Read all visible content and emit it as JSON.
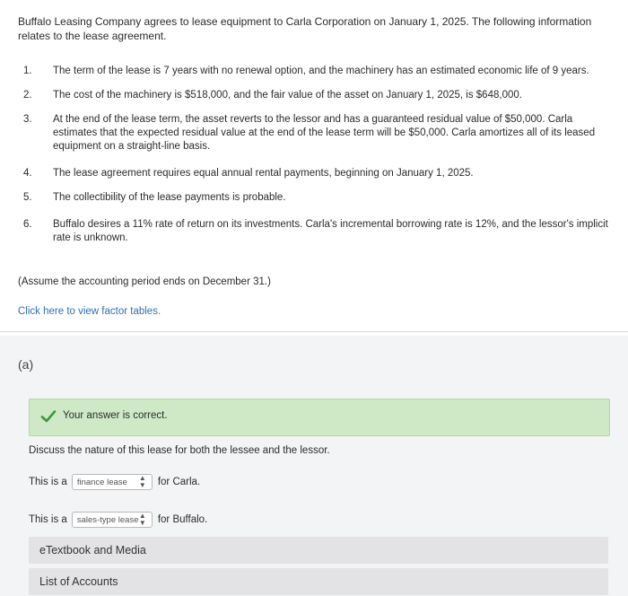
{
  "intro": "Buffalo Leasing Company agrees to lease equipment to Carla Corporation on January 1, 2025. The following information relates to the lease agreement.",
  "items": [
    {
      "num": "1.",
      "text": "The term of the lease is 7 years with no renewal option, and the machinery has an estimated economic life of 9 years."
    },
    {
      "num": "2.",
      "text": "The cost of the machinery is $518,000, and the fair value of the asset on January 1, 2025, is $648,000."
    },
    {
      "num": "3.",
      "text": "At the end of the lease term, the asset reverts to the lessor and has a guaranteed residual value of $50,000. Carla estimates that the expected residual value at the end of the lease term will be $50,000. Carla amortizes all of its leased equipment on a straight-line basis."
    },
    {
      "num": "4.",
      "text": "The lease agreement requires equal annual rental payments, beginning on January 1, 2025."
    },
    {
      "num": "5.",
      "text": "The collectibility of the lease payments is probable."
    },
    {
      "num": "6.",
      "text": "Buffalo desires a 11% rate of return on its investments. Carla's incremental borrowing rate is 12%, and the lessor's implicit rate is unknown."
    }
  ],
  "assume": "(Assume the accounting period ends on December 31.)",
  "factor_link": "Click here to view factor tables.",
  "part": {
    "label": "(a)",
    "banner": "Your answer is correct.",
    "question": "Discuss the nature of this lease for both the lessee and the lessor.",
    "line1": {
      "prefix": "This is a",
      "selected": "finance lease",
      "suffix": "for Carla."
    },
    "line2": {
      "prefix": "This is a",
      "selected": "sales-type lease",
      "suffix": "for Buffalo."
    },
    "etextbook": "eTextbook and Media",
    "accounts": "List of Accounts"
  },
  "colors": {
    "success_bg": "#cfe8c5",
    "check": "#3a9a3a",
    "link": "#2f6fb7"
  }
}
